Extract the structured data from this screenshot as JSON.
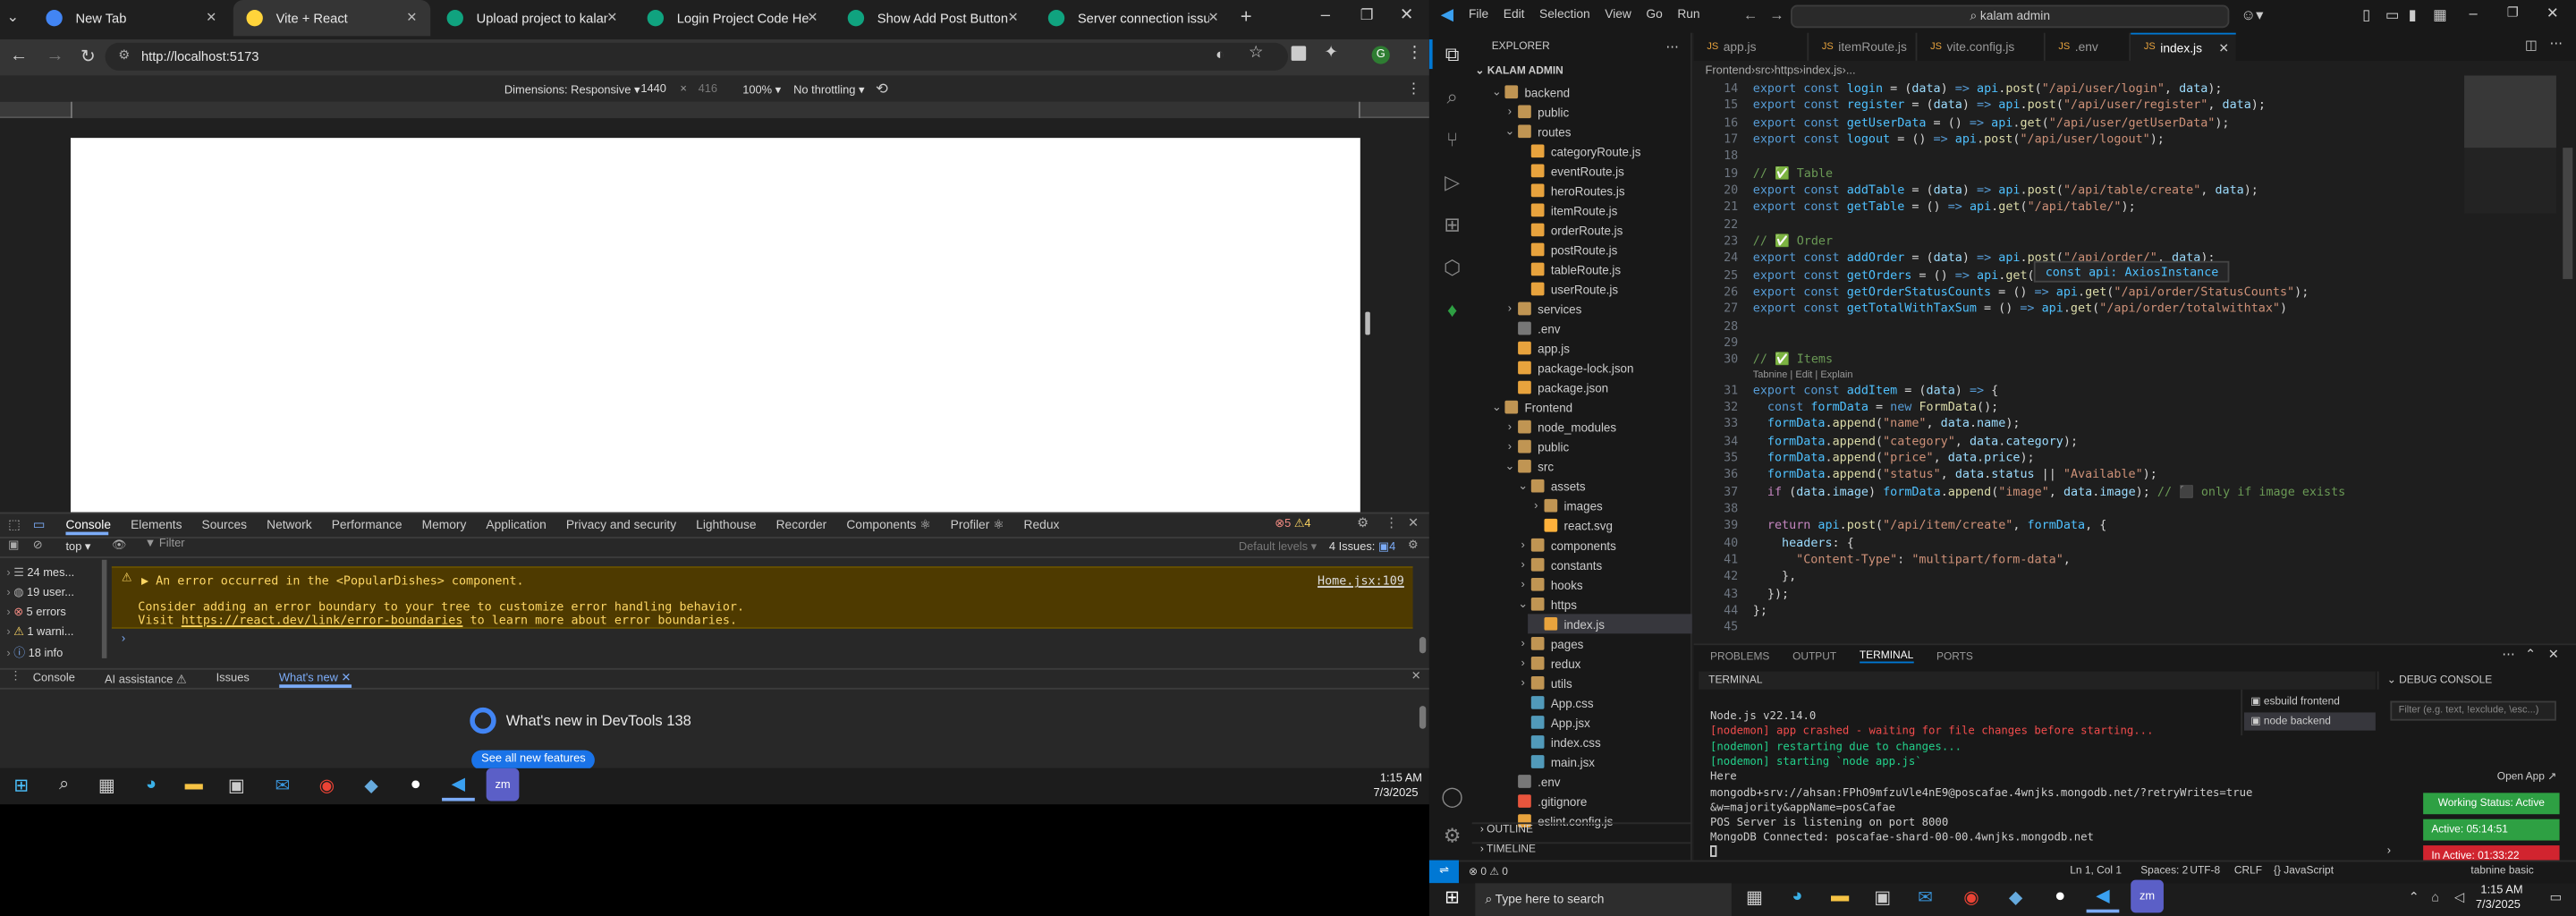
{
  "browser": {
    "tabs": [
      {
        "title": "New Tab"
      },
      {
        "title": "Vite + React"
      },
      {
        "title": "Upload project to kalams.org"
      },
      {
        "title": "Login Project Code Help"
      },
      {
        "title": "Show Add Post Button"
      },
      {
        "title": "Server connection issue fix"
      }
    ],
    "url": "http://localhost:5173",
    "profile_initial": "G",
    "device_toolbar": {
      "dimensions_label": "Dimensions: Responsive",
      "width": "1440",
      "height": "416",
      "zoom": "100%",
      "throttle": "No throttling"
    }
  },
  "devtools": {
    "tabs": [
      "Console",
      "Elements",
      "Sources",
      "Network",
      "Performance",
      "Memory",
      "Application",
      "Privacy and security",
      "Lighthouse",
      "Recorder",
      "Components ⚛",
      "Profiler ⚛",
      "Redux"
    ],
    "error_count": "5",
    "warn_count": "4",
    "context": "top",
    "filter_placeholder": "Filter",
    "levels": "Default levels",
    "issues": "4 Issues:",
    "issues_count": "4",
    "sidebar": [
      {
        "icon": "list-icon",
        "label": "24 mes..."
      },
      {
        "icon": "user-icon",
        "label": "19 user..."
      },
      {
        "icon": "error-icon",
        "label": "5 errors"
      },
      {
        "icon": "warning-icon",
        "label": "1 warni..."
      },
      {
        "icon": "info-icon",
        "label": "18 info"
      }
    ],
    "messages": [
      {
        "text": "▶ An error occurred in the <PopularDishes> component.",
        "source": "Home.jsx:109"
      },
      {
        "text": "Consider adding an error boundary to your tree to customize error handling behavior."
      },
      {
        "text": "Visit",
        "link": "https://react.dev/link/error-boundaries",
        "suffix": "to learn more about error boundaries."
      }
    ],
    "drawer_tabs": [
      "Console",
      "AI assistance ⚠",
      "Issues",
      "What's new"
    ],
    "whats_new_title": "What's new in DevTools 138",
    "whats_new_button": "See all new features"
  },
  "left_taskbar": {
    "time": "1:15 AM",
    "date": "7/3/2025"
  },
  "vscode": {
    "menu": [
      "File",
      "Edit",
      "Selection",
      "View",
      "Go",
      "Run"
    ],
    "search": "kalam admin",
    "explorer_title": "EXPLORER",
    "root": "KALAM ADMIN",
    "tree": [
      {
        "label": "backend",
        "d": 1,
        "t": "fo",
        "open": true
      },
      {
        "label": "public",
        "d": 2,
        "t": "fo"
      },
      {
        "label": "routes",
        "d": 2,
        "t": "fo",
        "open": true
      },
      {
        "label": "categoryRoute.js",
        "d": 3,
        "t": "js"
      },
      {
        "label": "eventRoute.js",
        "d": 3,
        "t": "js"
      },
      {
        "label": "heroRoutes.js",
        "d": 3,
        "t": "js"
      },
      {
        "label": "itemRoute.js",
        "d": 3,
        "t": "js"
      },
      {
        "label": "orderRoute.js",
        "d": 3,
        "t": "js"
      },
      {
        "label": "postRoute.js",
        "d": 3,
        "t": "js"
      },
      {
        "label": "tableRoute.js",
        "d": 3,
        "t": "js"
      },
      {
        "label": "userRoute.js",
        "d": 3,
        "t": "js"
      },
      {
        "label": "services",
        "d": 2,
        "t": "fo"
      },
      {
        "label": ".env",
        "d": 2,
        "t": "cfg"
      },
      {
        "label": "app.js",
        "d": 2,
        "t": "js"
      },
      {
        "label": "package-lock.json",
        "d": 2,
        "t": "json"
      },
      {
        "label": "package.json",
        "d": 2,
        "t": "json"
      },
      {
        "label": "Frontend",
        "d": 1,
        "t": "fo",
        "open": true
      },
      {
        "label": "node_modules",
        "d": 2,
        "t": "fo"
      },
      {
        "label": "public",
        "d": 2,
        "t": "fo"
      },
      {
        "label": "src",
        "d": 2,
        "t": "fo",
        "open": true
      },
      {
        "label": "assets",
        "d": 3,
        "t": "fo",
        "open": true
      },
      {
        "label": "images",
        "d": 4,
        "t": "fo"
      },
      {
        "label": "react.svg",
        "d": 4,
        "t": "svg"
      },
      {
        "label": "components",
        "d": 3,
        "t": "fo"
      },
      {
        "label": "constants",
        "d": 3,
        "t": "fo"
      },
      {
        "label": "hooks",
        "d": 3,
        "t": "fo"
      },
      {
        "label": "https",
        "d": 3,
        "t": "fo",
        "open": true
      },
      {
        "label": "index.js",
        "d": 4,
        "t": "js",
        "sel": true
      },
      {
        "label": "pages",
        "d": 3,
        "t": "fo"
      },
      {
        "label": "redux",
        "d": 3,
        "t": "fo"
      },
      {
        "label": "utils",
        "d": 3,
        "t": "fo"
      },
      {
        "label": "App.css",
        "d": 3,
        "t": "css"
      },
      {
        "label": "App.jsx",
        "d": 3,
        "t": "jsx"
      },
      {
        "label": "index.css",
        "d": 3,
        "t": "css"
      },
      {
        "label": "main.jsx",
        "d": 3,
        "t": "jsx"
      },
      {
        "label": ".env",
        "d": 2,
        "t": "cfg"
      },
      {
        "label": ".gitignore",
        "d": 2,
        "t": "git"
      },
      {
        "label": "eslint.config.js",
        "d": 2,
        "t": "js"
      }
    ],
    "outline": "OUTLINE",
    "timeline": "TIMELINE",
    "editor_tabs": [
      {
        "label": "app.js"
      },
      {
        "label": "itemRoute.js"
      },
      {
        "label": "vite.config.js"
      },
      {
        "label": ".env"
      },
      {
        "label": "index.js",
        "active": true
      }
    ],
    "breadcrumb": [
      "Frontend",
      "src",
      "https",
      "index.js",
      "..."
    ],
    "code": [
      {
        "n": "14",
        "t": "export const login = (data) => api.post(\"/api/user/login\", data);"
      },
      {
        "n": "15",
        "t": "export const register = (data) => api.post(\"/api/user/register\", data);"
      },
      {
        "n": "16",
        "t": "export const getUserData = () => api.get(\"/api/user/getUserData\");"
      },
      {
        "n": "17",
        "t": "export const logout = () => api.post(\"/api/user/logout\");"
      },
      {
        "n": "18",
        "t": ""
      },
      {
        "n": "19",
        "t": "// ✅ Table"
      },
      {
        "n": "20",
        "t": "export const addTable = (data) => api.post(\"/api/table/create\", data);"
      },
      {
        "n": "21",
        "t": "export const getTable = () => api.get(\"/api/table/\");"
      },
      {
        "n": "22",
        "t": ""
      },
      {
        "n": "23",
        "t": "// ✅ Order"
      },
      {
        "n": "24",
        "t": "export const addOrder = (data) => api.post(\"/api/order/\", data);"
      },
      {
        "n": "25",
        "t": "export const getOrders = () => api.get(\"/api/order/\");"
      },
      {
        "n": "26",
        "t": "export const getOrderStatusCounts = () => api.get(\"/api/order/StatusCounts\");"
      },
      {
        "n": "27",
        "t": "export const getTotalWithTaxSum = () => api.get(\"/api/order/totalwithtax\")"
      },
      {
        "n": "28",
        "t": ""
      },
      {
        "n": "29",
        "t": ""
      },
      {
        "n": "30",
        "t": "// ✅ Items"
      },
      {
        "n": "31",
        "t": "export const addItem = (data) => {"
      },
      {
        "n": "32",
        "t": "  const formData = new FormData();"
      },
      {
        "n": "33",
        "t": "  formData.append(\"name\", data.name);"
      },
      {
        "n": "34",
        "t": "  formData.append(\"category\", data.category);"
      },
      {
        "n": "35",
        "t": "  formData.append(\"price\", data.price);"
      },
      {
        "n": "36",
        "t": "  formData.append(\"status\", data.status || \"Available\");"
      },
      {
        "n": "37",
        "t": "  if (data.image) formData.append(\"image\", data.image); // ⬛ only if image exists"
      },
      {
        "n": "38",
        "t": ""
      },
      {
        "n": "39",
        "t": "  return api.post(\"/api/item/create\", formData, {"
      },
      {
        "n": "40",
        "t": "    headers: {"
      },
      {
        "n": "41",
        "t": "      \"Content-Type\": \"multipart/form-data\","
      },
      {
        "n": "42",
        "t": "    },"
      },
      {
        "n": "43",
        "t": "  });"
      },
      {
        "n": "44",
        "t": "};"
      },
      {
        "n": "45",
        "t": ""
      }
    ],
    "hover_tooltip": "const api: AxiosInstance",
    "codelens": "Tabnine | Edit | Explain",
    "panel_tabs": [
      "PROBLEMS",
      "OUTPUT",
      "TERMINAL",
      "PORTS"
    ],
    "terminal_title": "TERMINAL",
    "terminal_lines": [
      {
        "text": "Node.js v22.14.0",
        "c": "#cccccc"
      },
      {
        "text": "[nodemon] app crashed - waiting for file changes before starting...",
        "c": "#f14c4c"
      },
      {
        "text": "[nodemon] restarting due to changes...",
        "c": "#23d18b"
      },
      {
        "text": "[nodemon] starting `node app.js`",
        "c": "#23d18b"
      },
      {
        "text": "Here",
        "c": "#cccccc"
      },
      {
        "text": "mongodb+srv://ahsan:FPhO9mfzuVle4nE9@poscafae.4wnjks.mongodb.net/?retryWrites=true",
        "c": "#cccccc"
      },
      {
        "text": "&w=majority&appName=posCafae",
        "c": "#cccccc"
      },
      {
        "text": "POS Server is listening on port 8000",
        "c": "#cccccc"
      },
      {
        "text": "MongoDB Connected: poscafae-shard-00-00.4wnjks.mongodb.net",
        "c": "#cccccc"
      }
    ],
    "terminal_sessions": [
      {
        "label": "esbuild  frontend"
      },
      {
        "label": "node  backend"
      }
    ],
    "debug_console": "DEBUG CONSOLE",
    "debug_filter": "Filter (e.g. text, !exclude, \\esc...)",
    "open_app": "Open App ↗",
    "status_badges": [
      {
        "text": "Working Status: Active"
      },
      {
        "text": "Active: 05:14:51"
      },
      {
        "text": "In Active: 01:33:22"
      }
    ],
    "statusbar": {
      "problems": "⊗ 0 ⚠ 0",
      "position": "Ln 1, Col 1",
      "spaces": "Spaces: 2",
      "encoding": "UTF-8",
      "eol": "CRLF",
      "lang": "{} JavaScript",
      "tabnine": "tabnine basic"
    }
  },
  "right_taskbar": {
    "search": "Type here to search",
    "time": "1:15 AM",
    "date": "7/3/2025"
  },
  "colors": {
    "accent": "#0078d4",
    "vscode_bg": "#1e1e1e",
    "sidebar_bg": "#181818",
    "devtools_bg": "#282828",
    "error": "#f14c4c",
    "badge_green": "#2ea043",
    "badge_red": "#d1242f"
  }
}
